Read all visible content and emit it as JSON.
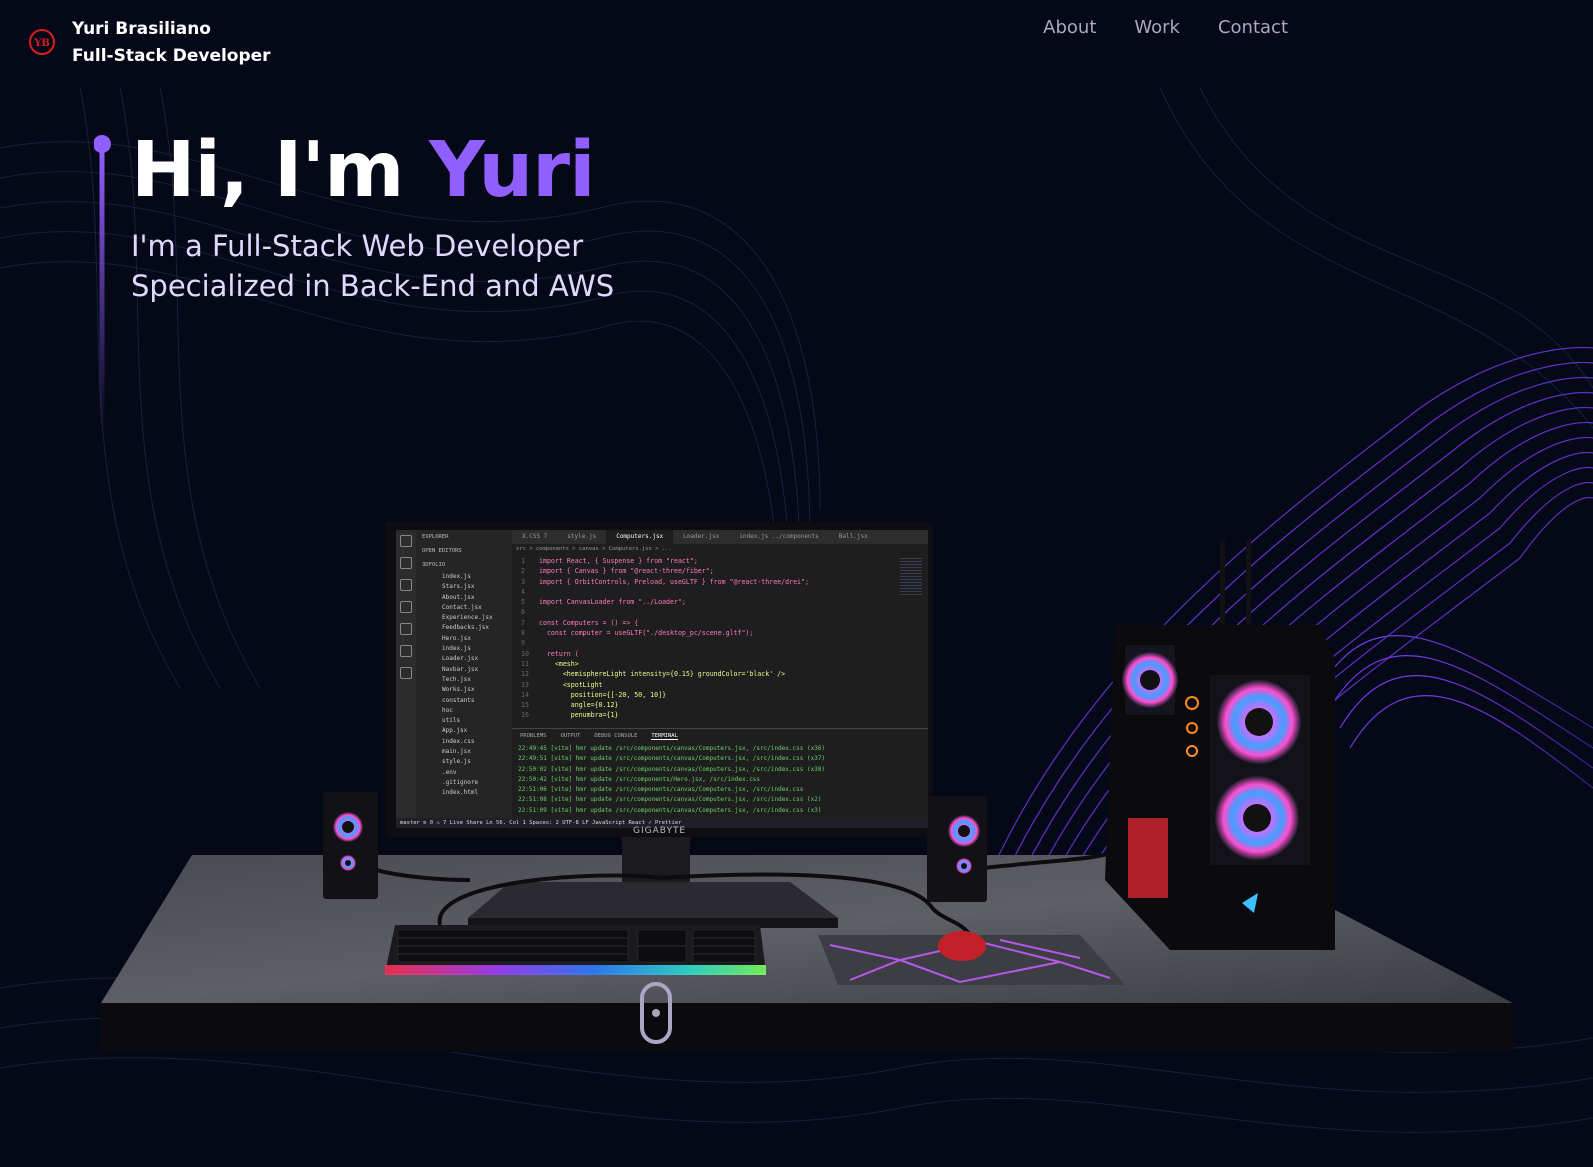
{
  "navbar": {
    "logo_text": "YB",
    "brand_name": "Yuri Brasiliano",
    "brand_role": "Full-Stack Developer",
    "links": [
      {
        "label": "About"
      },
      {
        "label": "Work"
      },
      {
        "label": "Contact"
      }
    ]
  },
  "hero": {
    "greeting": "Hi, I'm ",
    "name": "Yuri",
    "subtitle_line1": "I'm a Full-Stack Web Developer",
    "subtitle_line2": "Specialized in Back-End and AWS"
  },
  "colors": {
    "background": "#050816",
    "accent": "#915eff",
    "nav_text": "#aaa6c3",
    "logo_red": "#d81e1e"
  },
  "scene": {
    "monitor_brand": "GIGABYTE",
    "editor": {
      "explorer_title": "EXPLORER",
      "open_editors": "OPEN EDITORS",
      "project": "3DFOLIO",
      "files": [
        "index.js",
        "Stars.jsx",
        "About.jsx",
        "Contact.jsx",
        "Experience.jsx",
        "Feedbacks.jsx",
        "Hero.jsx",
        "index.js",
        "Loader.jsx",
        "Navbar.jsx",
        "Tech.jsx",
        "Works.jsx",
        "constants",
        "hoc",
        "utils",
        "App.jsx",
        "index.css",
        "main.jsx",
        "style.js",
        ".env",
        ".gitignore",
        "index.html"
      ],
      "tabs": [
        "X.CSS 7",
        "style.js",
        "Computers.jsx",
        "Loader.jsx",
        "index.js ../components",
        "Ball.jsx"
      ],
      "breadcrumb": "src > components > canvas > Computers.jsx > ...",
      "code_lines": [
        {
          "n": "1",
          "t": "import React, { Suspense } from \"react\";"
        },
        {
          "n": "2",
          "t": "import { Canvas } from \"@react-three/fiber\";"
        },
        {
          "n": "3",
          "t": "import { OrbitControls, Preload, useGLTF } from \"@react-three/drei\";"
        },
        {
          "n": "4",
          "t": ""
        },
        {
          "n": "5",
          "t": "import CanvasLoader from \"../Loader\";"
        },
        {
          "n": "6",
          "t": ""
        },
        {
          "n": "7",
          "t": "const Computers = () => {"
        },
        {
          "n": "8",
          "t": "  const computer = useGLTF(\"./desktop_pc/scene.gltf\");"
        },
        {
          "n": "9",
          "t": ""
        },
        {
          "n": "10",
          "t": "  return ("
        },
        {
          "n": "11",
          "t": "    <mesh>"
        },
        {
          "n": "12",
          "t": "      <hemisphereLight intensity={0.15} groundColor='black' />"
        },
        {
          "n": "13",
          "t": "      <spotLight"
        },
        {
          "n": "14",
          "t": "        position={[-20, 50, 10]}"
        },
        {
          "n": "15",
          "t": "        angle={0.12}"
        },
        {
          "n": "16",
          "t": "        penumbra={1}"
        }
      ],
      "panel_tabs": [
        "PROBLEMS",
        "OUTPUT",
        "DEBUG CONSOLE",
        "TERMINAL"
      ],
      "terminal_lines": [
        "22:49:45 [vite] hmr update /src/components/canvas/Computers.jsx, /src/index.css (x36)",
        "22:49:51 [vite] hmr update /src/components/canvas/Computers.jsx, /src/index.css (x37)",
        "22:50:02 [vite] hmr update /src/components/canvas/Computers.jsx, /src/index.css (x38)",
        "22:50:42 [vite] hmr update /src/components/Hero.jsx, /src/index.css",
        "22:51:06 [vite] hmr update /src/components/canvas/Computers.jsx, /src/index.css",
        "22:51:08 [vite] hmr update /src/components/canvas/Computers.jsx, /src/index.css (x2)",
        "22:51:09 [vite] hmr update /src/components/canvas/Computers.jsx, /src/index.css (x3)"
      ],
      "status": "master  ⊘ 0 ⚠ 7   Live Share          Ln 56, Col 1  Spaces: 2  UTF-8  LF  JavaScript React  ✓ Prettier"
    }
  }
}
